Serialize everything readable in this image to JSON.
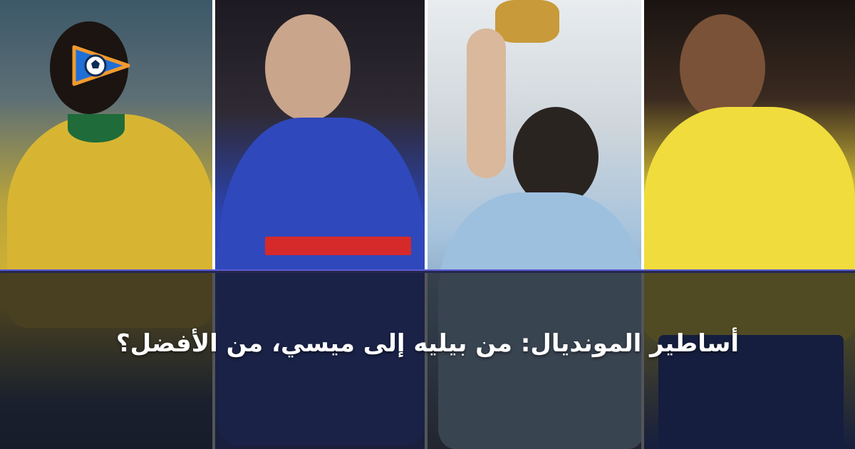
{
  "headline": "أساطير المونديال: من بيليه إلى ميسي، من الأفضل؟",
  "colors": {
    "accent": "#5b5bd6",
    "logo_primary": "#1f6fd6",
    "logo_secondary": "#f29a2e"
  },
  "icons": {
    "logo": "play-ball-logo"
  },
  "photos": [
    {
      "jersey": "yellow-green"
    },
    {
      "jersey": "blue-10"
    },
    {
      "jersey": "light-blue-white"
    },
    {
      "jersey": "yellow-9"
    }
  ]
}
